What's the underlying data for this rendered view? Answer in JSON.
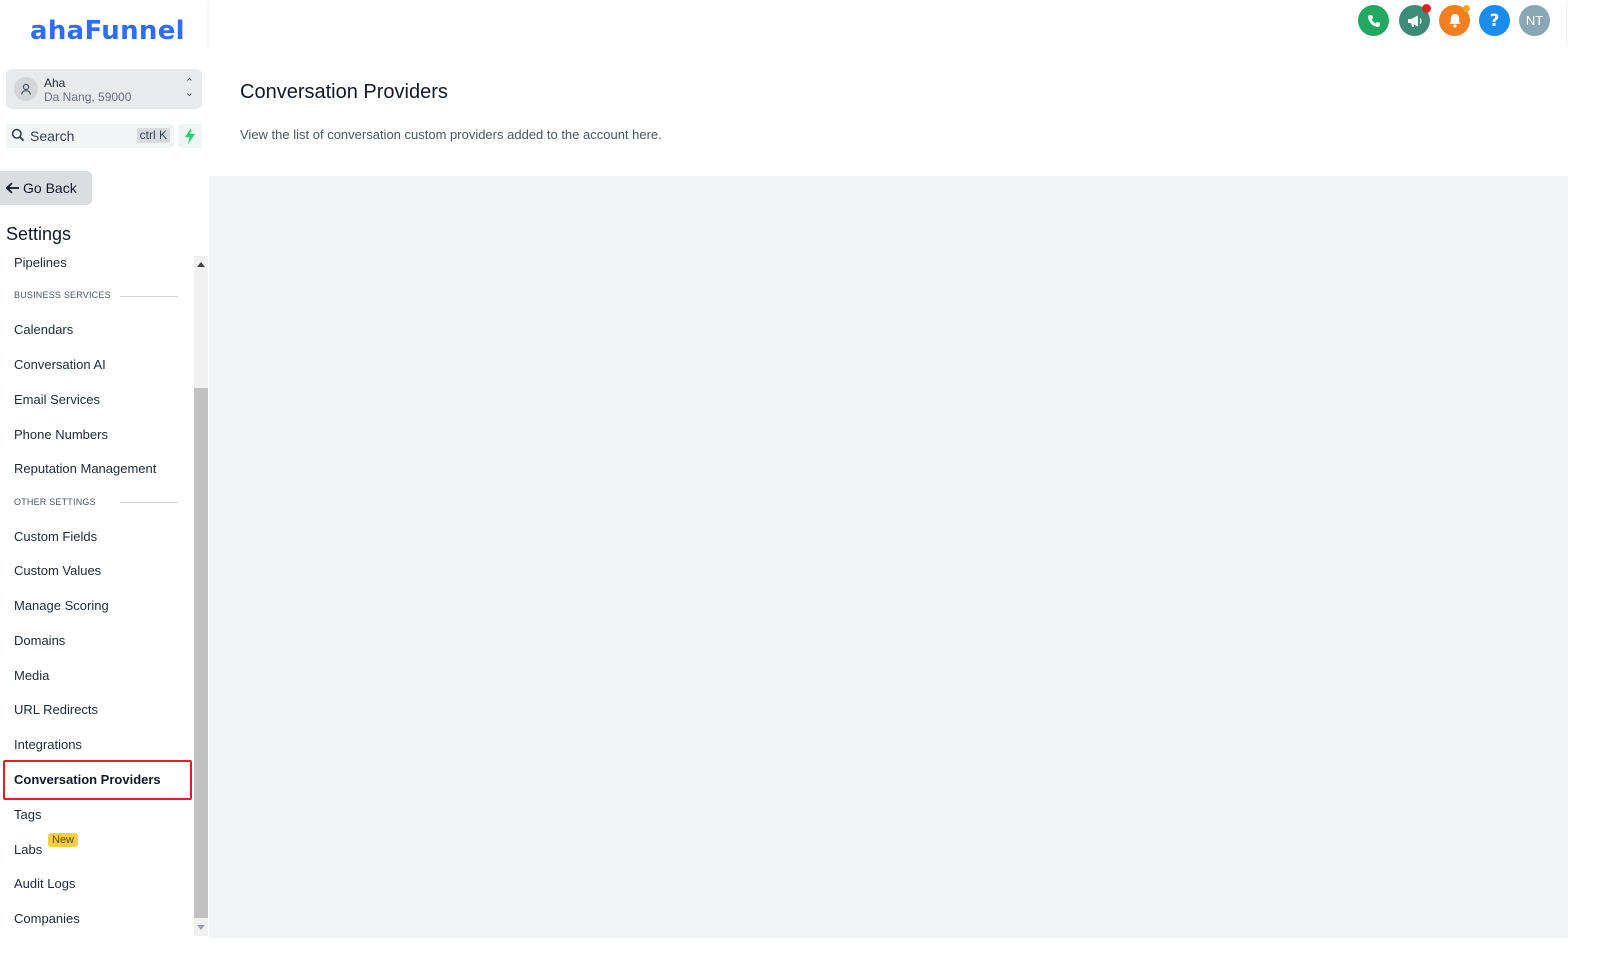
{
  "brand": {
    "logo": "ahaFunnel",
    "color": "#2f6df6"
  },
  "account": {
    "name": "Aha",
    "location": "Da Nang, 59000"
  },
  "search": {
    "label": "Search",
    "shortcut": "ctrl K"
  },
  "go_back": "Go Back",
  "settings_title": "Settings",
  "nav": {
    "pipelines": "Pipelines",
    "section_business": "BUSINESS SERVICES",
    "calendars": "Calendars",
    "conversation_ai": "Conversation AI",
    "email_services": "Email Services",
    "phone_numbers": "Phone Numbers",
    "reputation_management": "Reputation Management",
    "section_other": "OTHER SETTINGS",
    "custom_fields": "Custom Fields",
    "custom_values": "Custom Values",
    "manage_scoring": "Manage Scoring",
    "domains": "Domains",
    "media": "Media",
    "url_redirects": "URL Redirects",
    "integrations": "Integrations",
    "conversation_providers": "Conversation Providers",
    "tags": "Tags",
    "labs": "Labs",
    "labs_badge": "New",
    "audit_logs": "Audit Logs",
    "companies": "Companies"
  },
  "topbar": {
    "phone_color": "#22a861",
    "announce_color": "#3d8c77",
    "notif_color": "#f57e20",
    "help_color": "#1a8cf0",
    "avatar_color": "#8aa7b6",
    "avatar_initials": "NT"
  },
  "page": {
    "title": "Conversation Providers",
    "subtitle": "View the list of conversation custom providers added to the account here."
  }
}
